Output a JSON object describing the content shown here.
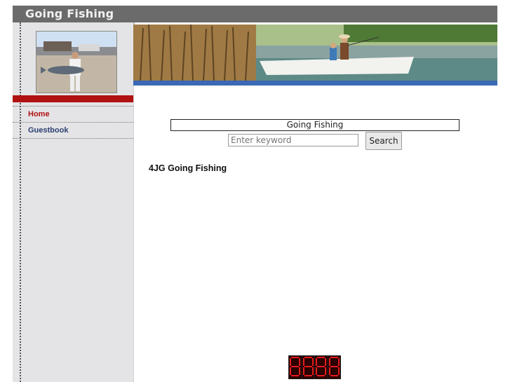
{
  "site": {
    "title": "Going Fishing"
  },
  "sidebar": {
    "nav": [
      {
        "label": "Home"
      },
      {
        "label": "Guestbook"
      }
    ]
  },
  "main": {
    "site_name": "Going Fishing",
    "search": {
      "placeholder": "Enter keyword",
      "button_label": "Search"
    },
    "heading": "4JG Going Fishing"
  },
  "colors": {
    "header_bg": "#6b6b6b",
    "accent_red": "#b01212",
    "accent_blue": "#3a69b6",
    "sidebar_bg": "#e4e4e6"
  },
  "counter": {
    "digits": 4
  }
}
